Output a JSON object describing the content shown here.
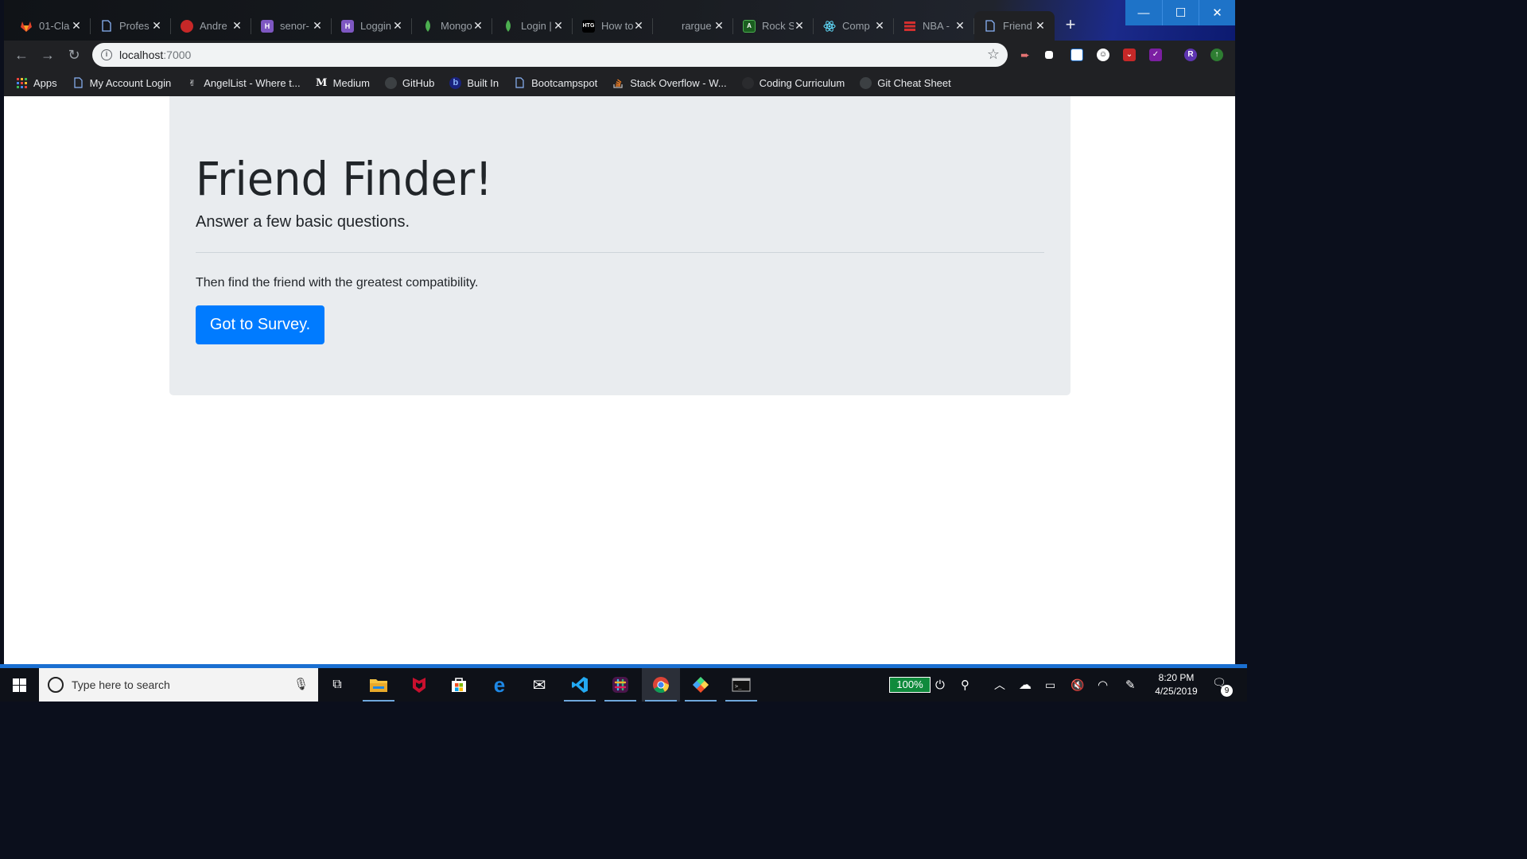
{
  "browser": {
    "tabs": [
      {
        "title": "01-Cla",
        "icon": "gitlab-icon",
        "color": "#e24329"
      },
      {
        "title": "Profes",
        "icon": "page-icon",
        "color": "#8ab4f8"
      },
      {
        "title": "Andre",
        "icon": "avatar-icon",
        "color": "#c62828"
      },
      {
        "title": "senor-",
        "icon": "heroku-icon",
        "color": "#7e57c2"
      },
      {
        "title": "Loggin",
        "icon": "heroku-icon",
        "color": "#7e57c2"
      },
      {
        "title": "Mongo",
        "icon": "mongodb-leaf-icon",
        "color": "#4caf50"
      },
      {
        "title": "Login |",
        "icon": "mongodb-leaf-icon",
        "color": "#4caf50"
      },
      {
        "title": "How to",
        "icon": "htg-icon",
        "color": "#000000"
      },
      {
        "title": "rargue",
        "icon": "blank-icon",
        "color": "#202124"
      },
      {
        "title": "Rock S",
        "icon": "replit-icon",
        "color": "#1b5e20"
      },
      {
        "title": "Comp",
        "icon": "react-icon",
        "color": "#61dafb"
      },
      {
        "title": "NBA -",
        "icon": "nba-icon",
        "color": "#d32f2f"
      },
      {
        "title": "Friend",
        "icon": "page-icon",
        "color": "#8ab4f8"
      }
    ],
    "active_tab_index": 12,
    "tab_close": "✕",
    "new_tab": "+",
    "window_controls": {
      "minimize": "—",
      "maximize": "☐",
      "close": "✕"
    },
    "nav": {
      "back": "←",
      "forward": "→",
      "reload": "↻"
    },
    "address": {
      "host": "localhost",
      "port": ":7000"
    },
    "bookmarks": [
      {
        "label": "Apps",
        "icon": "apps-grid-icon"
      },
      {
        "label": "My Account Login",
        "icon": "page-icon"
      },
      {
        "label": "AngelList - Where t...",
        "icon": "angellist-icon"
      },
      {
        "label": "Medium",
        "icon": "medium-icon"
      },
      {
        "label": "GitHub",
        "icon": "github-icon"
      },
      {
        "label": "Built In",
        "icon": "builtin-icon"
      },
      {
        "label": "Bootcampspot",
        "icon": "page-icon"
      },
      {
        "label": "Stack Overflow - W...",
        "icon": "stackoverflow-icon"
      },
      {
        "label": "Coding Curriculum",
        "icon": "github-icon"
      },
      {
        "label": "Git Cheat Sheet",
        "icon": "github-icon"
      }
    ]
  },
  "page": {
    "title": "Friend Finder!",
    "lead": "Answer a few basic questions.",
    "text": "Then find the friend with the greatest compatibility.",
    "button": "Got to Survey."
  },
  "taskbar": {
    "search_placeholder": "Type here to search",
    "battery": "100%",
    "time": "8:20 PM",
    "date": "4/25/2019",
    "notifications": "9"
  }
}
